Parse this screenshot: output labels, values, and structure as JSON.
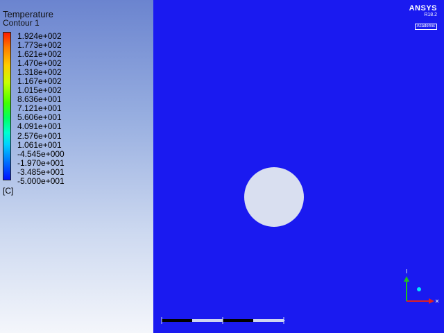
{
  "legend": {
    "title": "Temperature",
    "subtitle": "Contour 1",
    "ticks": [
      "1.924e+002",
      "1.773e+002",
      "1.621e+002",
      "1.470e+002",
      "1.318e+002",
      "1.167e+002",
      "1.015e+002",
      "8.636e+001",
      "7.121e+001",
      "5.606e+001",
      "4.091e+001",
      "2.576e+001",
      "1.061e+001",
      "-4.545e+000",
      "-1.970e+001",
      "-3.485e+001",
      "-5.000e+001"
    ],
    "unit": "[C]"
  },
  "logo": {
    "name": "ANSYS",
    "version": "R18.2",
    "edition": "Academic"
  },
  "colors": {
    "domain": "#1a1af0",
    "hole": "#d9dff0"
  }
}
